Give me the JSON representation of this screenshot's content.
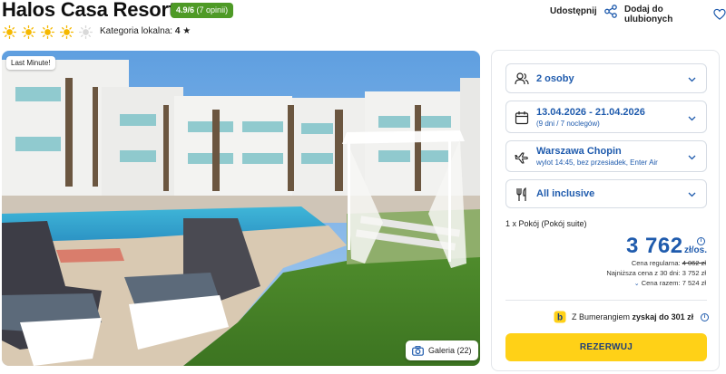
{
  "hotel": {
    "name": "Halos Casa Resort",
    "rating_score": "4.9/6",
    "rating_count": "(7 opinii)",
    "sun_rating": 4,
    "sun_max": 5,
    "category_label": "Kategoria lokalna:",
    "category_value": "4",
    "category_icon": "star-icon"
  },
  "header_actions": {
    "share_label": "Udostępnij",
    "share_icon": "share-icon",
    "favorite_label": "Dodaj do ulubionych",
    "favorite_icon": "heart-icon"
  },
  "photo": {
    "badge": "Last Minute!",
    "gallery_label": "Galeria (22)",
    "gallery_icon": "camera-icon"
  },
  "booking": {
    "guests": {
      "label": "2 osoby",
      "icon": "people-icon"
    },
    "dates": {
      "label": "13.04.2026 - 21.04.2026",
      "sub": "(9 dni / 7 noclegów)",
      "icon": "calendar-icon"
    },
    "flight": {
      "label": "Warszawa Chopin",
      "sub": "wylot 14:45, bez przesiadek, Enter Air",
      "icon": "plane-icon"
    },
    "board": {
      "label": "All inclusive",
      "icon": "cutlery-icon"
    },
    "room": "1 x Pokój  (Pokój suite)",
    "price": "3 762",
    "price_unit": "zł/os.",
    "regular_price_label": "Cena regularna:",
    "regular_price": "4 062 zł",
    "lowest_30_label": "Najniższa cena z 30 dni:",
    "lowest_30": "3 752 zł",
    "total_label": "Cena razem:",
    "total": "7 524 zł",
    "bumerang_prefix": "Z Bumerangiem",
    "bumerang_bold": "zyskaj do 301 zł",
    "reserve_label": "REZERWUJ"
  },
  "colors": {
    "accent_blue": "#1f5bad",
    "rating_green": "#4e9a26",
    "cta_yellow": "#ffd117",
    "sun_yellow": "#f5b800"
  }
}
